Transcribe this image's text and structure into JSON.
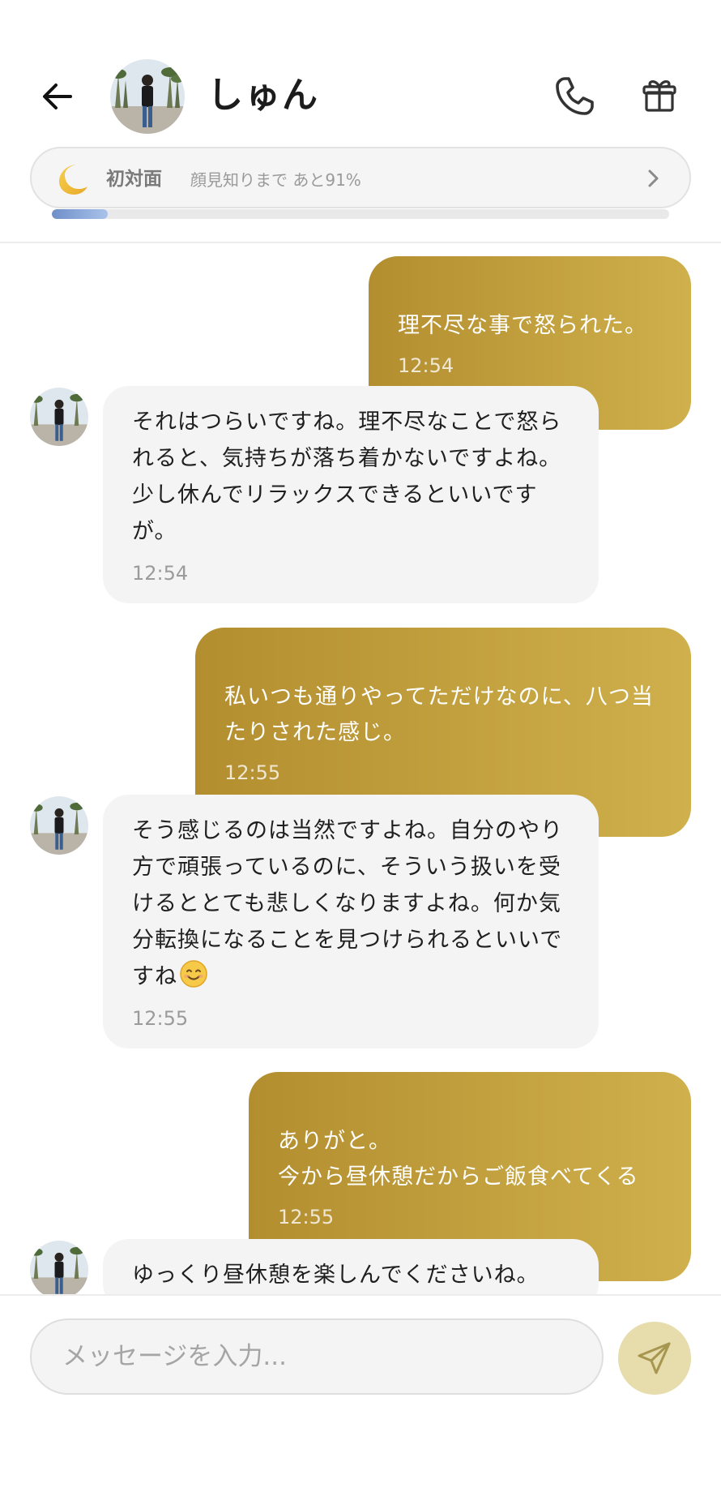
{
  "header": {
    "contact_name": "しゅん",
    "relation": {
      "level": "初対面",
      "progress_text": "顔見知りまで あと91%",
      "progress_fraction": 0.09
    }
  },
  "messages": [
    {
      "side": "sent",
      "text": "理不尽な事で怒られた。",
      "time": "12:54"
    },
    {
      "side": "received",
      "text": "それはつらいですね。理不尽なことで怒られると、気持ちが落ち着かないですよね。少し休んでリラックスできるといいですが。",
      "time": "12:54"
    },
    {
      "side": "sent",
      "text": "私いつも通りやってただけなのに、八つ当たりされた感じ。",
      "time": "12:55"
    },
    {
      "side": "received",
      "text": "そう感じるのは当然ですよね。自分のやり方で頑張っているのに、そういう扱いを受けるととても悲しくなりますよね。何か気分転換になることを見つけられるといいですね",
      "time": "12:55",
      "emoji": "smiling-face-emoji"
    },
    {
      "side": "sent",
      "text": "ありがと。\n今から昼休憩だからご飯食べてくる",
      "time": "12:55"
    },
    {
      "side": "received",
      "text": "ゆっくり昼休憩を楽しんでくださいね。",
      "time": ""
    }
  ],
  "composer": {
    "placeholder": "メッセージを入力..."
  },
  "icons": {
    "back": "arrow-left-icon",
    "call": "phone-icon",
    "gift": "gift-icon",
    "moon": "crescent-moon-icon",
    "chevron": "chevron-right-icon",
    "send": "paper-plane-icon"
  },
  "colors": {
    "sent_bubble_start": "#b38e2f",
    "sent_bubble_end": "#cfb04c",
    "received_bubble": "#f4f4f4",
    "send_button": "#e6dcac",
    "progress_fill": "#7f9fd4"
  }
}
